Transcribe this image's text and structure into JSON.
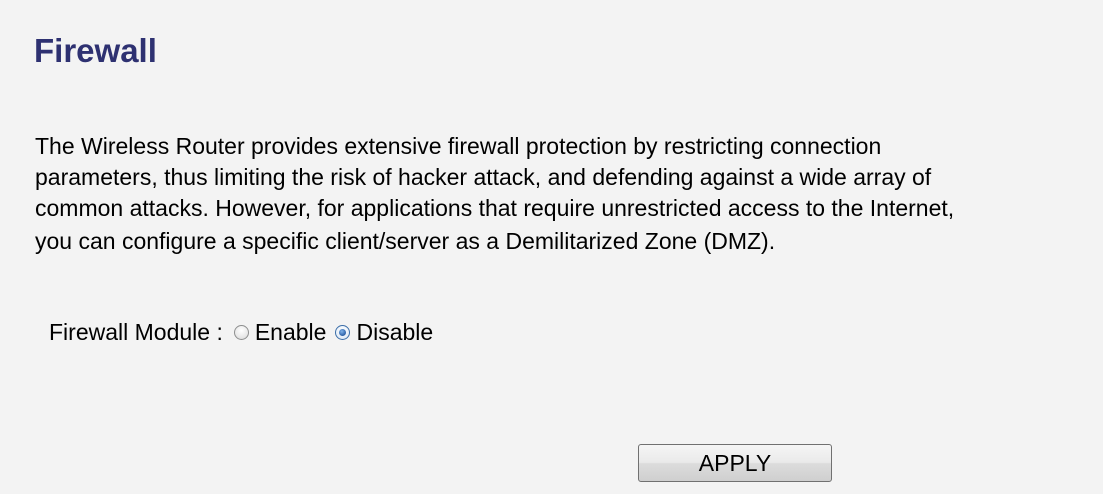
{
  "page": {
    "title": "Firewall",
    "description_lines": [
      "The Wireless Router provides extensive firewall protection by restricting connection",
      "parameters, thus limiting the risk of hacker attack, and defending against a wide array of",
      "common attacks. However, for applications that require unrestricted access to the Internet,",
      "you can configure a specific client/server as a Demilitarized Zone (DMZ)."
    ]
  },
  "firewall_module": {
    "label": "Firewall Module :",
    "options": [
      {
        "label": "Enable",
        "selected": false
      },
      {
        "label": "Disable",
        "selected": true
      }
    ]
  },
  "actions": {
    "apply_label": "APPLY"
  },
  "colors": {
    "background": "#f3f3f3",
    "title": "#2e3171",
    "text": "#000000"
  }
}
